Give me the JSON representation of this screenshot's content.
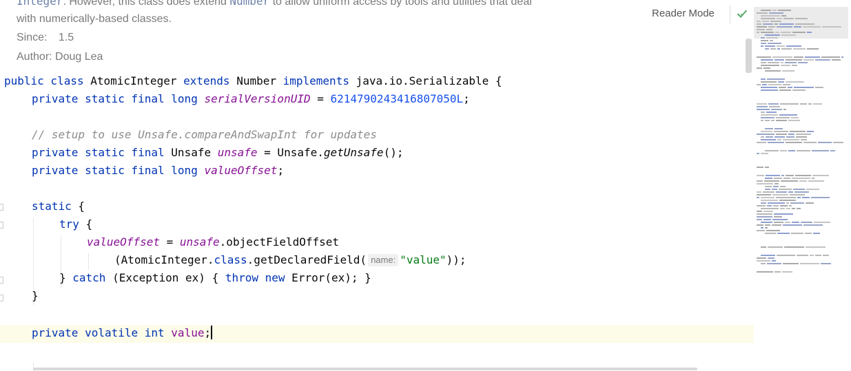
{
  "javadoc": {
    "line1_code": "Integer",
    "line1_text": ". However, this class does extend ",
    "line1_code2": "Number",
    "line1_text2": " to allow uniform access by tools and utilities that deal",
    "line2": "with numerically-based classes.",
    "since_label": "Since:",
    "since_value": "1.5",
    "author_label": "Author:",
    "author_value": "Doug Lea"
  },
  "toolbar": {
    "reader_mode_label": "Reader Mode",
    "inspection_icon": "check-icon",
    "accent": "#59a869"
  },
  "code": {
    "l1": {
      "kw1": "public class",
      "name": "AtomicInteger",
      "kw2": "extends",
      "sup": "Number",
      "kw3": "implements",
      "iface": "java.io.Serializable {"
    },
    "l2": {
      "mods": "private static final long",
      "field": "serialVersionUID",
      "op": " = ",
      "num": "6214790243416807050L",
      ";": ";"
    },
    "l3": {
      "comment": "// setup to use Unsafe.compareAndSwapInt for updates"
    },
    "l4": {
      "mods": "private static final",
      "type": "Unsafe",
      "field": "unsafe",
      "op": " = Unsafe.",
      "method": "getUnsafe",
      "tail": "();"
    },
    "l5": {
      "mods": "private static final long",
      "field": "valueOffset",
      "tail": ";"
    },
    "l6": {
      "kw": "static",
      "tail": " {"
    },
    "l7": {
      "kw": "try",
      "tail": " {"
    },
    "l8": {
      "field": "valueOffset",
      "op": " = ",
      "field2": "unsafe",
      "tail": ".objectFieldOffset"
    },
    "l9": {
      "head": "(AtomicInteger.",
      "kw": "class",
      "mid": ".getDeclaredField(",
      "hint": "name:",
      "str": "\"value\"",
      "tail": "));"
    },
    "l10": {
      "head": "} ",
      "kw1": "catch",
      "mid": " (Exception ex) { ",
      "kw2": "throw",
      "sp": " ",
      "kw3": "new",
      "tail": " Error(ex); }"
    },
    "l11": {
      "tail": "}"
    },
    "l12": {
      "mods": "private volatile int",
      "field": "value",
      "tail": ";"
    }
  },
  "colors": {
    "keyword": "#0033b3",
    "field": "#871094",
    "number": "#1750eb",
    "string": "#067d17",
    "comment": "#8c8c8c",
    "current_line": "#fdfce9"
  }
}
